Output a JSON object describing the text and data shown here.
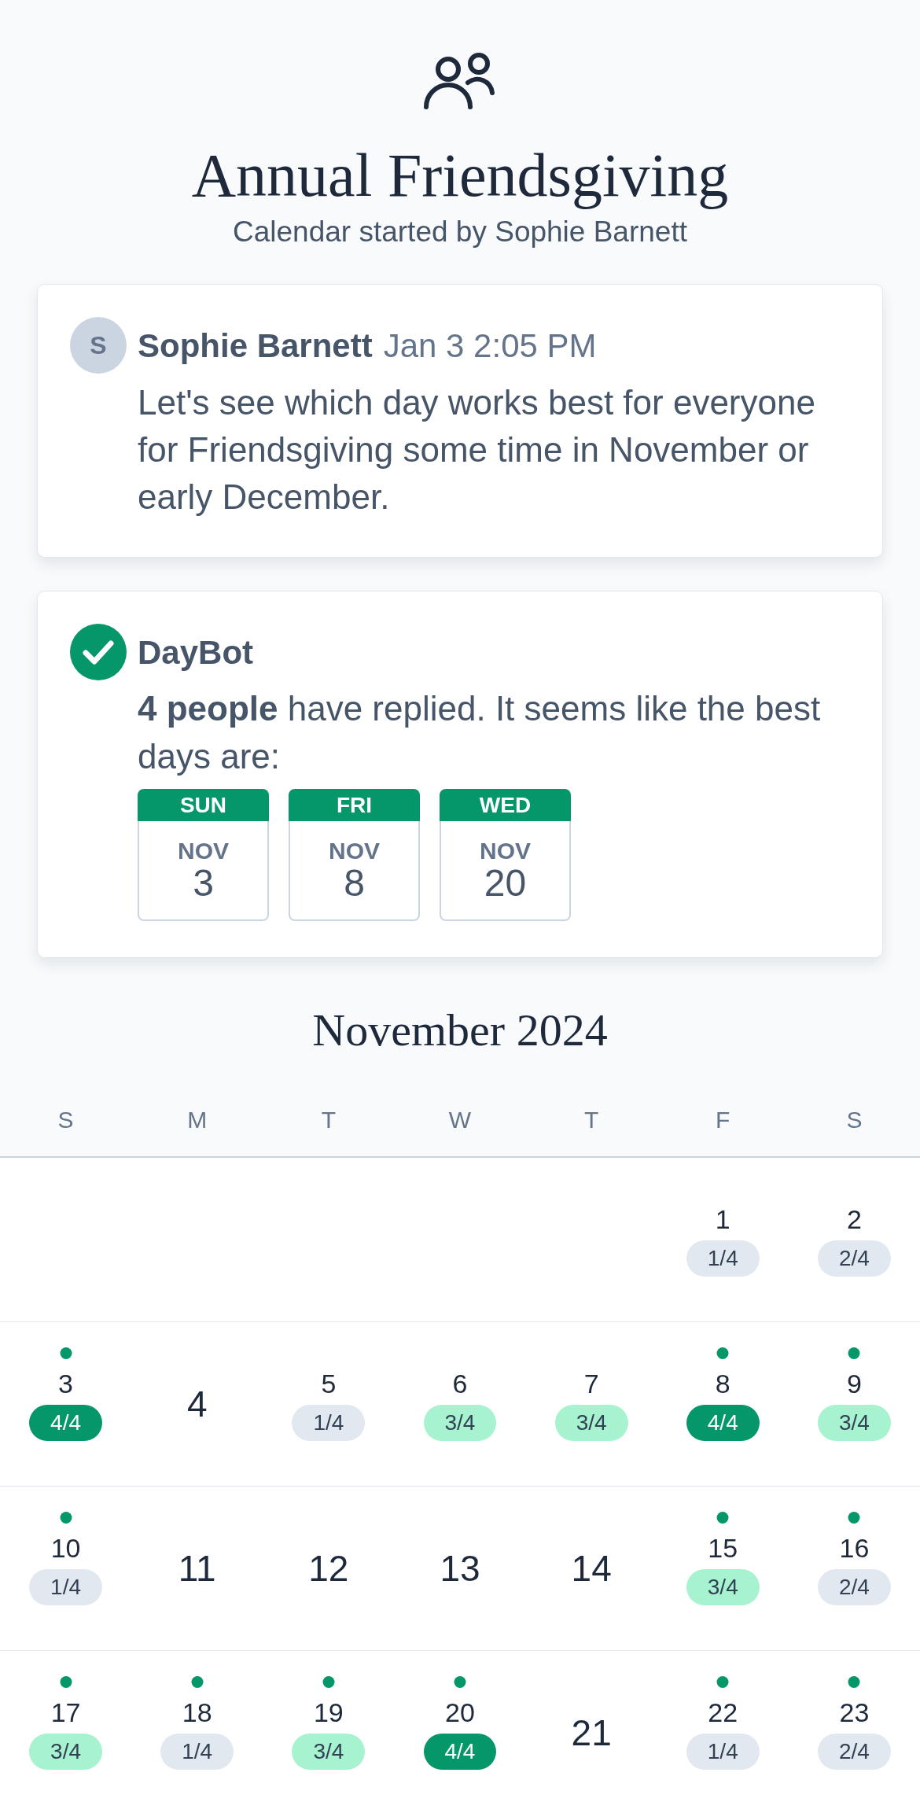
{
  "header": {
    "title": "Annual Friendsgiving",
    "subtitle": "Calendar started by Sophie Barnett"
  },
  "messages": [
    {
      "kind": "comment",
      "avatar": "S",
      "author": "Sophie Barnett",
      "time": "Jan 3 2:05 PM",
      "text": "Let's see which day works best for everyone for Friendsgiving some time in November or early December."
    },
    {
      "kind": "bot",
      "author": "DayBot",
      "text": "**4 people** have replied. It seems like the best days are:",
      "best_days": [
        {
          "weekday": "SUN",
          "month": "NOV",
          "day": "3"
        },
        {
          "weekday": "FRI",
          "month": "NOV",
          "day": "8"
        },
        {
          "weekday": "WED",
          "month": "NOV",
          "day": "20"
        }
      ]
    }
  ],
  "calendar": {
    "month": "November 2024",
    "weekdays": [
      "S",
      "M",
      "T",
      "W",
      "T",
      "F",
      "S"
    ],
    "weeks": [
      {
        "days": [
          {
            "day": "1",
            "marked": false,
            "votes": "1/4",
            "color": "#e2e8f0"
          },
          {
            "day": "2",
            "marked": false,
            "votes": "2/4",
            "color": "#e2e8f0"
          }
        ]
      },
      {
        "days": [
          {
            "day": "3",
            "marked": true,
            "votes": "4/4",
            "color": "#059669"
          },
          {
            "day": "4",
            "marked": false
          },
          {
            "day": "5",
            "marked": false,
            "votes": "1/4",
            "color": "#e2e8f0"
          },
          {
            "day": "6",
            "marked": false,
            "votes": "3/4",
            "color": "#a7f3d0"
          },
          {
            "day": "7",
            "marked": false,
            "votes": "3/4",
            "color": "#a7f3d0"
          },
          {
            "day": "8",
            "marked": true,
            "votes": "4/4",
            "color": "#059669"
          },
          {
            "day": "9",
            "marked": true,
            "votes": "3/4",
            "color": "#a7f3d0"
          }
        ]
      },
      {
        "days": [
          {
            "day": "10",
            "marked": true,
            "votes": "1/4",
            "color": "#e2e8f0"
          },
          {
            "day": "11",
            "marked": false
          },
          {
            "day": "12",
            "marked": false
          },
          {
            "day": "13",
            "marked": false
          },
          {
            "day": "14",
            "marked": false
          },
          {
            "day": "15",
            "marked": true,
            "votes": "3/4",
            "color": "#a7f3d0"
          },
          {
            "day": "16",
            "marked": true,
            "votes": "2/4",
            "color": "#e2e8f0"
          }
        ]
      },
      {
        "days": [
          {
            "day": "17",
            "marked": true,
            "votes": "3/4",
            "color": "#a7f3d0"
          },
          {
            "day": "18",
            "marked": true,
            "votes": "1/4",
            "color": "#e2e8f0"
          },
          {
            "day": "19",
            "marked": true,
            "votes": "3/4",
            "color": "#a7f3d0"
          },
          {
            "day": "20",
            "marked": true,
            "votes": "4/4",
            "color": "#059669"
          },
          {
            "day": "21",
            "marked": false
          },
          {
            "day": "22",
            "marked": true,
            "votes": "1/4",
            "color": "#e2e8f0"
          },
          {
            "day": "23",
            "marked": true,
            "votes": "2/4",
            "color": "#e2e8f0"
          }
        ]
      }
    ]
  }
}
